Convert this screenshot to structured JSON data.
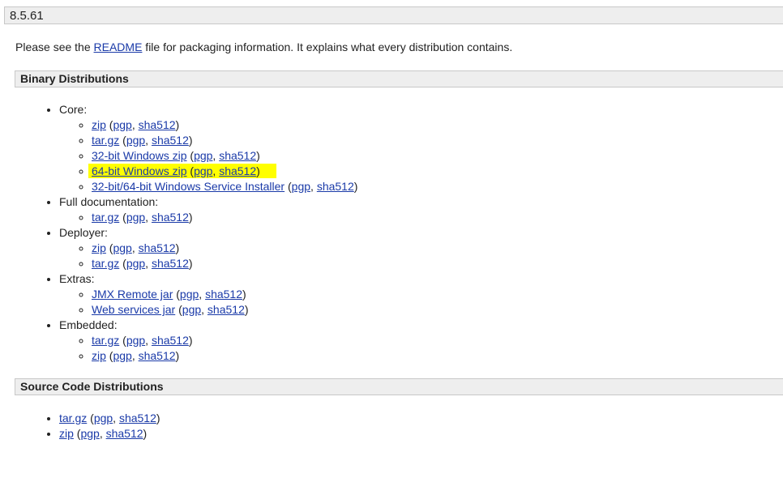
{
  "version": "8.5.61",
  "intro": {
    "before": "Please see the ",
    "link": "README",
    "after": " file for packaging information. It explains what every distribution contains."
  },
  "binary": {
    "heading": "Binary Distributions",
    "groups": [
      {
        "label": "Core:",
        "items": [
          {
            "main": "zip",
            "sig": "pgp",
            "hash": "sha512"
          },
          {
            "main": "tar.gz",
            "sig": "pgp",
            "hash": "sha512"
          },
          {
            "main": "32-bit Windows zip",
            "sig": "pgp",
            "hash": "sha512"
          },
          {
            "main": "64-bit Windows zip",
            "sig": "pgp",
            "hash": "sha512",
            "highlight": true
          },
          {
            "main": "32-bit/64-bit Windows Service Installer",
            "sig": "pgp",
            "hash": "sha512"
          }
        ]
      },
      {
        "label": "Full documentation:",
        "items": [
          {
            "main": "tar.gz",
            "sig": "pgp",
            "hash": "sha512"
          }
        ]
      },
      {
        "label": "Deployer:",
        "items": [
          {
            "main": "zip",
            "sig": "pgp",
            "hash": "sha512"
          },
          {
            "main": "tar.gz",
            "sig": "pgp",
            "hash": "sha512"
          }
        ]
      },
      {
        "label": "Extras:",
        "items": [
          {
            "main": "JMX Remote jar",
            "sig": "pgp",
            "hash": "sha512"
          },
          {
            "main": "Web services jar",
            "sig": "pgp",
            "hash": "sha512"
          }
        ]
      },
      {
        "label": "Embedded:",
        "items": [
          {
            "main": "tar.gz",
            "sig": "pgp",
            "hash": "sha512"
          },
          {
            "main": "zip",
            "sig": "pgp",
            "hash": "sha512"
          }
        ]
      }
    ]
  },
  "source": {
    "heading": "Source Code Distributions",
    "items": [
      {
        "main": "tar.gz",
        "sig": "pgp",
        "hash": "sha512"
      },
      {
        "main": "zip",
        "sig": "pgp",
        "hash": "sha512"
      }
    ]
  },
  "colors": {
    "link": "#1a3aa8",
    "highlight": "#ffff00",
    "bar_background": "#eeeeee"
  }
}
